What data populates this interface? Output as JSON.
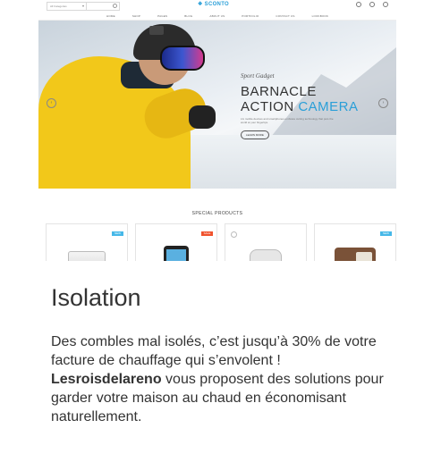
{
  "website": {
    "category_select": "All Categories",
    "logo": "SCONTO",
    "menu": [
      "HOME",
      "SHOP",
      "PAGES",
      "BLOG",
      "ABOUT US",
      "PORTFOLIO",
      "CONTACT US",
      "LOOKBOOK"
    ],
    "hero": {
      "subtitle": "Sport Gadget",
      "title_line1": "BARNACLE",
      "title_line2_part1": "ACTION ",
      "title_line2_accent": "CAMERA",
      "description": "LG mobile devices and smartphones embrace cutting technology that puts the world at your fingertips.",
      "button": "LEARN MORE",
      "prev_icon": "arrow-left-icon",
      "next_icon": "arrow-right-icon"
    },
    "special_title": "SPECIAL PRODUCTS",
    "badges": [
      {
        "label": "NEW",
        "color": "#46b8e8"
      },
      {
        "label": "SALE",
        "color": "#f0522d"
      },
      {
        "label": "NEW",
        "color": "#46b8e8"
      }
    ],
    "accent_color": "#2a9fd8"
  },
  "article": {
    "title": "Isolation",
    "para1": "Des combles mal isolés, c’est jusqu’à 30% de votre facture de chauffage qui s’envolent !",
    "brand": "Lesroisdelareno",
    "para2": " vous proposent des solutions pour garder votre maison au chaud en économisant naturellement."
  }
}
